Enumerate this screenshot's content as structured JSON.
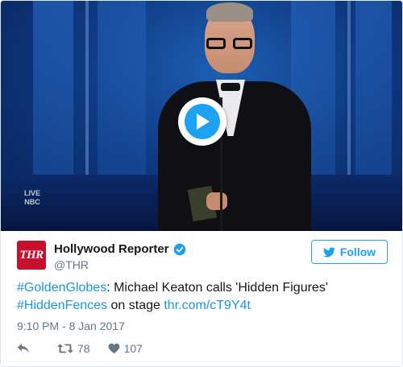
{
  "video": {
    "network_logo_text": "LIVE\nNBC"
  },
  "author": {
    "avatar_text": "THR",
    "display_name": "Hollywood Reporter",
    "handle": "@THR",
    "verified": true
  },
  "follow_button": {
    "label": "Follow"
  },
  "tweet": {
    "hashtag1": "#GoldenGlobes",
    "text1": ": Michael Keaton calls 'Hidden Figures'",
    "hashtag2": "#HiddenFences",
    "text2": " on stage ",
    "link": "thr.com/cT9Y4t",
    "timestamp": "9:10 PM - 8 Jan 2017"
  },
  "actions": {
    "retweet_count": "78",
    "like_count": "107"
  },
  "colors": {
    "accent": "#1da1f2",
    "link": "#1b95e0",
    "muted": "#657786",
    "brand_red": "#c8102e"
  }
}
